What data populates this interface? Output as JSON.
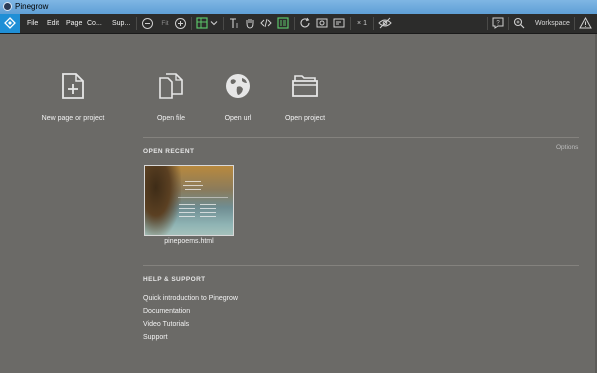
{
  "window": {
    "title": "Pinegrow"
  },
  "menu": [
    "File",
    "Edit",
    "Page",
    "Co...",
    "Sup..."
  ],
  "toolbar": {
    "fit_label": "Fit",
    "multiplier_label": "× 1",
    "workspace_label": "Workspace"
  },
  "actions": [
    {
      "label": "New page or project",
      "icon": "new-page-icon"
    },
    {
      "label": "Open file",
      "icon": "open-file-icon"
    },
    {
      "label": "Open url",
      "icon": "globe-icon"
    },
    {
      "label": "Open project",
      "icon": "folder-icon"
    }
  ],
  "recent": {
    "title": "OPEN RECENT",
    "options_label": "Options",
    "items": [
      {
        "name": "pinepoems.html"
      }
    ]
  },
  "help": {
    "title": "HELP & SUPPORT",
    "links": [
      "Quick introduction to Pinegrow",
      "Documentation",
      "Video Tutorials",
      "Support"
    ]
  },
  "colors": {
    "titlebar": "#6fa9dd",
    "toolbar": "#2c2c2b",
    "accent": "#1f8fd6",
    "background": "#6b6a67",
    "green_icon": "#5cc46a"
  }
}
